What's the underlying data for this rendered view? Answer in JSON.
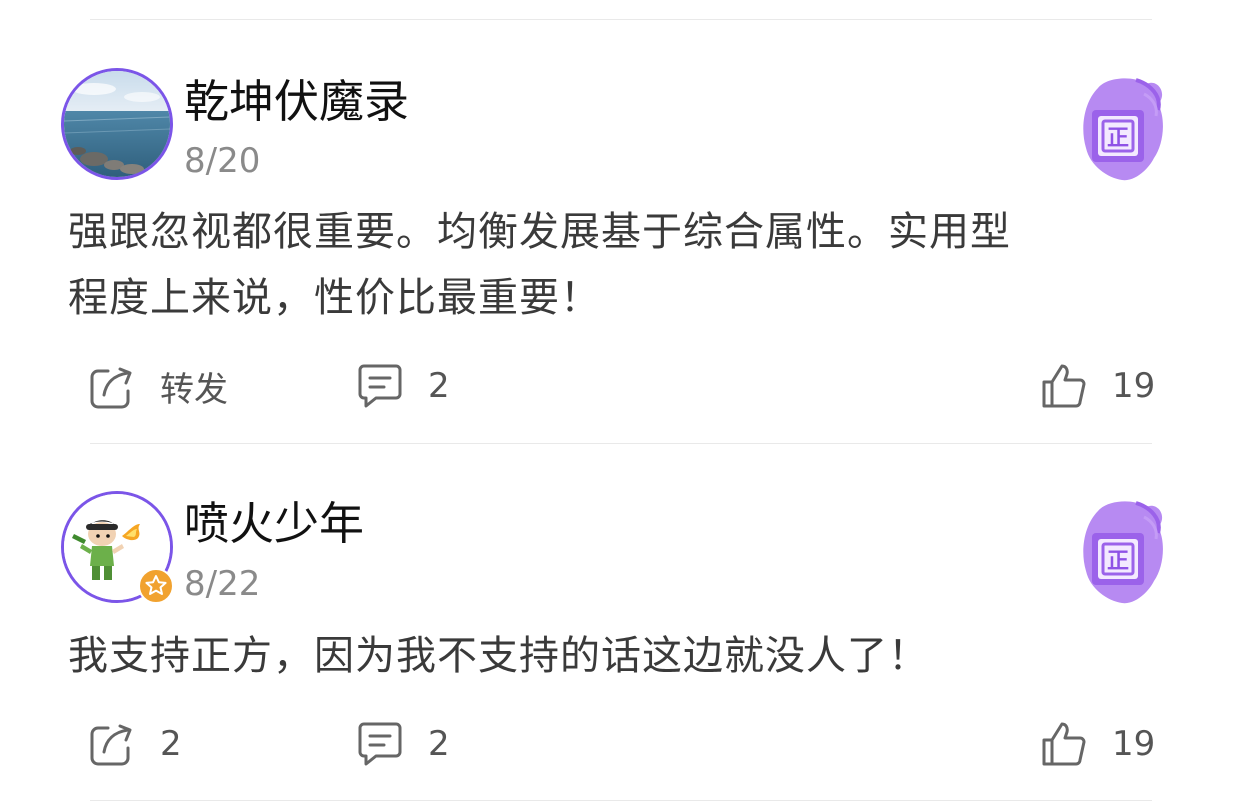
{
  "colors": {
    "accent": "#7b55e8",
    "stance_purple": "#a873ee",
    "vip_orange": "#f1a22f",
    "divider": "#e9e9e9"
  },
  "posts": [
    {
      "username": "乾坤伏魔录",
      "date": "8/20",
      "content_line1": "强跟忽视都很重要。均衡发展基于综合属性。实用型",
      "content_line2": "程度上来说，性价比最重要！",
      "stance_badge": "正",
      "share_label": "转发",
      "comment_count": "2",
      "like_count": "19",
      "icons": {
        "share": "share-icon",
        "comment": "comment-icon",
        "like": "thumbs-up-icon"
      }
    },
    {
      "username": "喷火少年",
      "date": "8/22",
      "content_line1": "我支持正方，因为我不支持的话这边就没人了！",
      "stance_badge": "正",
      "share_label": "2",
      "comment_count": "2",
      "like_count": "19",
      "icons": {
        "share": "share-icon",
        "comment": "comment-icon",
        "like": "thumbs-up-icon"
      }
    }
  ]
}
